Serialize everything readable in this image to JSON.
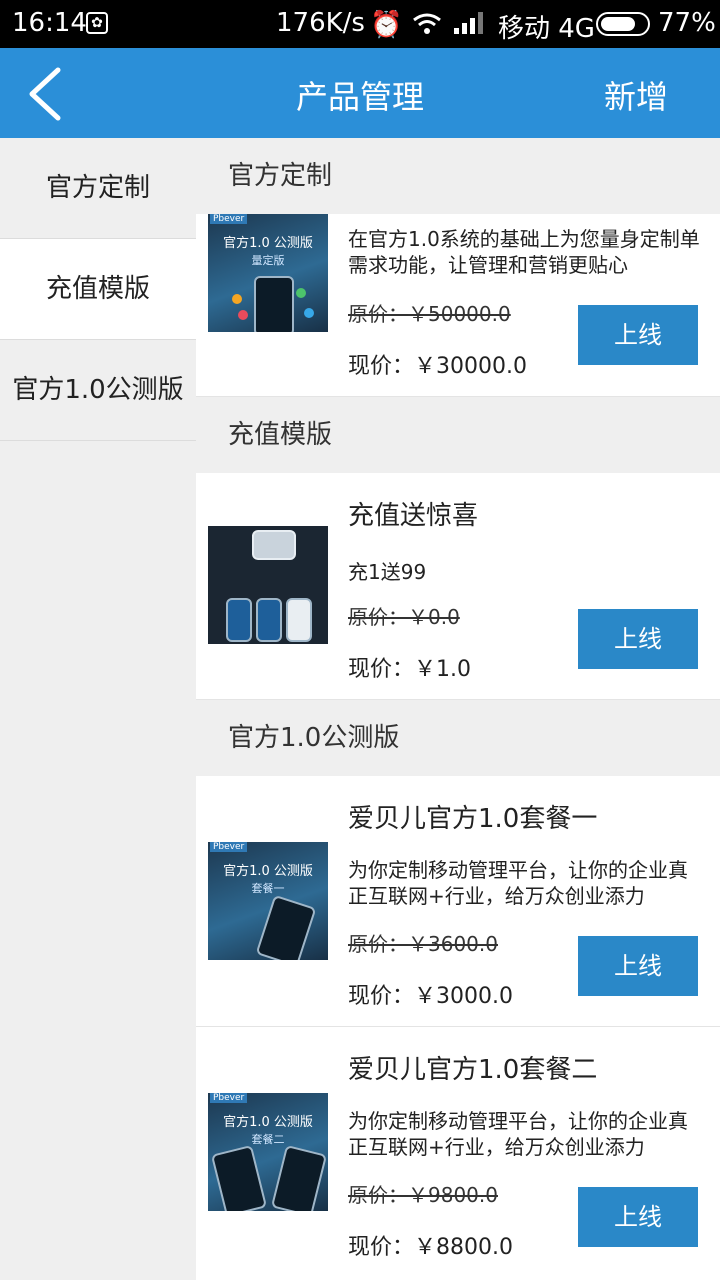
{
  "status_bar": {
    "time": "16:14",
    "network_speed": "176K/s",
    "carrier": "移动 4G",
    "battery_percent": "77%",
    "battery_level": 0.77
  },
  "header": {
    "title": "产品管理",
    "add_label": "新增",
    "color": "#2b8fd8"
  },
  "sidebar": {
    "items": [
      {
        "label": "官方定制",
        "active": false
      },
      {
        "label": "充值模版",
        "active": true
      },
      {
        "label": "官方1.0公测版",
        "active": false
      }
    ]
  },
  "sections": [
    {
      "title": "官方定制",
      "products": [
        {
          "thumb_title": "官方1.0  公测版",
          "thumb_sub": "量定版",
          "thumb_brand": "Pbever",
          "description": "在官方1.0系统的基础上为您量身定制单需求功能，让管理和营销更贴心",
          "original_price": "原价：￥50000.0",
          "current_price": "现价：￥30000.0",
          "button_label": "上线"
        }
      ]
    },
    {
      "title": "充值模版",
      "products": [
        {
          "name": "充值送惊喜",
          "subtitle": "充1送99",
          "original_price": "原价：￥0.0",
          "current_price": "现价：￥1.0",
          "button_label": "上线"
        }
      ]
    },
    {
      "title": "官方1.0公测版",
      "products": [
        {
          "thumb_title": "官方1.0  公测版",
          "thumb_sub": "套餐一",
          "thumb_brand": "Pbever",
          "name": "爱贝儿官方1.0套餐一",
          "description": "为你定制移动管理平台，让你的企业真正互联网+行业，给万众创业添力",
          "original_price": "原价：￥3600.0",
          "current_price": "现价：￥3000.0",
          "button_label": "上线"
        },
        {
          "thumb_title": "官方1.0  公测版",
          "thumb_sub": "套餐二",
          "thumb_brand": "Pbever",
          "name": "爱贝儿官方1.0套餐二",
          "description": "为你定制移动管理平台，让你的企业真正互联网+行业，给万众创业添力",
          "original_price": "原价：￥9800.0",
          "current_price": "现价：￥8800.0",
          "button_label": "上线"
        }
      ]
    }
  ]
}
